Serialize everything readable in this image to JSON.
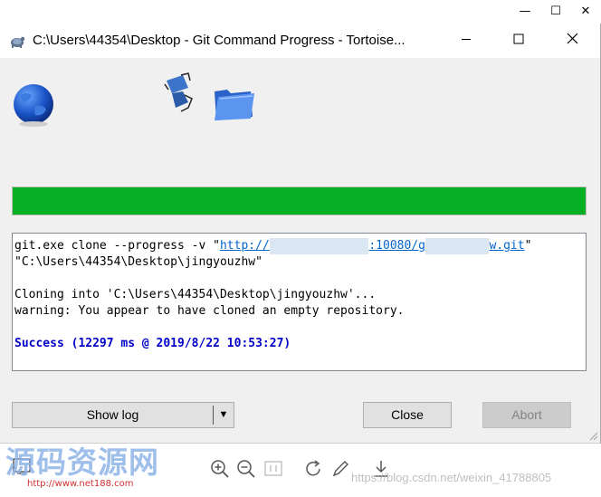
{
  "outer_window": {
    "minimize_glyph": "—",
    "maximize_glyph": "☐",
    "close_glyph": "✕"
  },
  "dialog": {
    "title": "C:\\Users\\44354\\Desktop - Git Command Progress - Tortoise...",
    "minimize_glyph": "—",
    "maximize_glyph": "☐",
    "close_glyph": "✕"
  },
  "progress": {
    "fraction": 1.0,
    "color": "#06b025"
  },
  "log": {
    "cmd_prefix": "git.exe clone --progress -v \"",
    "url_part1": "http://",
    "url_masked1": "              ",
    "url_part2": ":10080/g",
    "url_masked2": "         ",
    "url_part3": "w.git",
    "cmd_suffix": "\"",
    "target_path": "\"C:\\Users\\44354\\Desktop\\jingyouzhw\"",
    "cloning": "Cloning into 'C:\\Users\\44354\\Desktop\\jingyouzhw'...",
    "warning": "warning: You appear to have cloned an empty repository.",
    "success": "Success (12297 ms @ 2019/8/22 10:53:27)",
    "success_color": "#0000c8"
  },
  "buttons": {
    "show_log": "Show log",
    "close": "Close",
    "abort": "Abort"
  },
  "watermark": {
    "text": "源码资源网",
    "url": "http://www.net188.com"
  },
  "csdn_text": "https://blog.csdn.net/weixin_41788805"
}
